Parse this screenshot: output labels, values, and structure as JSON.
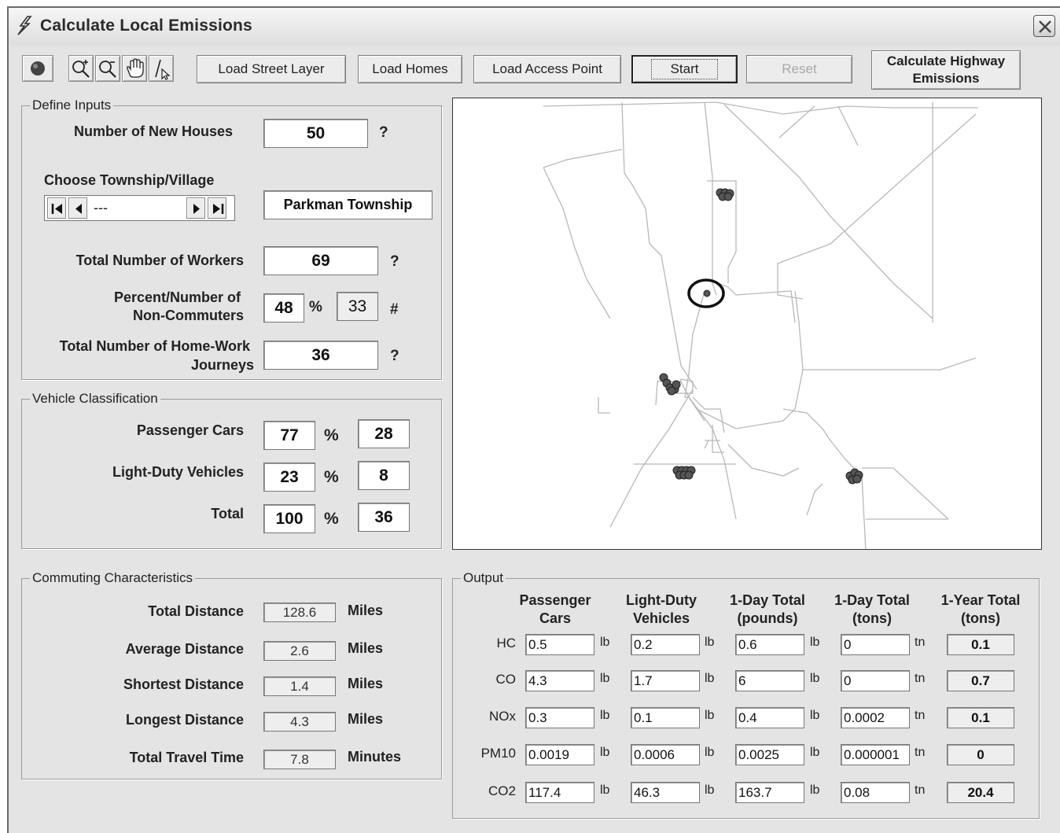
{
  "window": {
    "title": "Calculate Local Emissions"
  },
  "toolbar": {
    "tools": [
      "globe-icon",
      "zoom-in-icon",
      "zoom-out-icon",
      "hand-pan-icon",
      "select-pointer-icon"
    ],
    "load_street_layer": "Load Street Layer",
    "load_homes": "Load Homes",
    "load_access_point": "Load Access Point",
    "start": "Start",
    "reset": "Reset",
    "calc_highway_line1": "Calculate Highway",
    "calc_highway_line2": "Emissions"
  },
  "define_inputs": {
    "group_label": "Define Inputs",
    "new_houses_label": "Number of New Houses",
    "new_houses_value": "50",
    "help_1": "?",
    "township_label": "Choose Township/Village",
    "township_nav_value": "---",
    "township_value": "Parkman Township",
    "workers_label": "Total Number of Workers",
    "workers_value": "69",
    "help_2": "?",
    "noncommuters_label_1": "Percent/Number of",
    "noncommuters_label_2": "Non-Commuters",
    "noncommuters_pct": "48",
    "pct_symbol": "%",
    "noncommuters_num": "33",
    "num_symbol": "#",
    "journeys_label_1": "Total Number of Home-Work",
    "journeys_label_2": "Journeys",
    "journeys_value": "36",
    "help_3": "?"
  },
  "vehicle_classification": {
    "group_label": "Vehicle Classification",
    "pct_symbol": "%",
    "rows": [
      {
        "label": "Passenger Cars",
        "pct": "77",
        "count": "28"
      },
      {
        "label": "Light-Duty Vehicles",
        "pct": "23",
        "count": "8"
      },
      {
        "label": "Total",
        "pct": "100",
        "count": "36"
      }
    ]
  },
  "commuting": {
    "group_label": "Commuting Characteristics",
    "rows": [
      {
        "label": "Total Distance",
        "value": "128.6",
        "unit": "Miles"
      },
      {
        "label": "Average Distance",
        "value": "2.6",
        "unit": "Miles"
      },
      {
        "label": "Shortest Distance",
        "value": "1.4",
        "unit": "Miles"
      },
      {
        "label": "Longest Distance",
        "value": "4.3",
        "unit": "Miles"
      },
      {
        "label": "Total Travel Time",
        "value": "7.8",
        "unit": "Minutes"
      }
    ]
  },
  "output": {
    "group_label": "Output",
    "headers": [
      {
        "line1": "Passenger",
        "line2": "Cars"
      },
      {
        "line1": "Light-Duty",
        "line2": "Vehicles"
      },
      {
        "line1": "1-Day Total",
        "line2": "(pounds)"
      },
      {
        "line1": "1-Day Total",
        "line2": "(tons)"
      },
      {
        "line1": "1-Year Total",
        "line2": "(tons)"
      }
    ],
    "unit_lb": "lb",
    "unit_tn": "tn",
    "rows": [
      {
        "pollutant": "HC",
        "cars": "0.5",
        "ldv": "0.2",
        "day_lb": "0.6",
        "day_tn": "0",
        "year_tn": "0.1"
      },
      {
        "pollutant": "CO",
        "cars": "4.3",
        "ldv": "1.7",
        "day_lb": "6",
        "day_tn": "0",
        "year_tn": "0.7"
      },
      {
        "pollutant": "NOx",
        "cars": "0.3",
        "ldv": "0.1",
        "day_lb": "0.4",
        "day_tn": "0.0002",
        "year_tn": "0.1"
      },
      {
        "pollutant": "PM10",
        "cars": "0.0019",
        "ldv": "0.0006",
        "day_lb": "0.0025",
        "day_tn": "0.000001",
        "year_tn": "0"
      },
      {
        "pollutant": "CO2",
        "cars": "117.4",
        "ldv": "46.3",
        "day_lb": "163.7",
        "day_tn": "0.08",
        "year_tn": "20.4"
      }
    ]
  },
  "colors": {
    "window_bg": "#e4e4e4",
    "map_road": "#b8b8b8",
    "map_home": "#555555",
    "access_ring": "#111111"
  }
}
